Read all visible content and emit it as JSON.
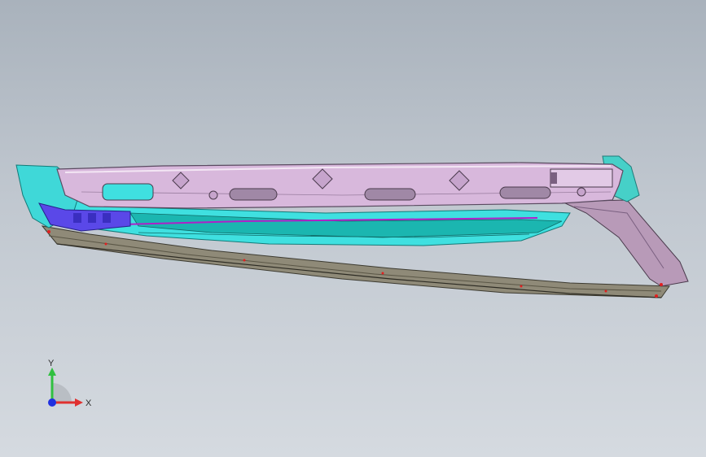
{
  "viewport": {
    "background_top": "#a9b2bc",
    "background_bottom": "#d5dae0"
  },
  "model": {
    "colors": {
      "outer_panel": "#d8b8dc",
      "panel_edge": "#5a4a60",
      "inner_cyan": "#3fe0e0",
      "inner_teal": "#1bb6b0",
      "blue_parts": "#5a48e8",
      "magenta_line": "#b020c8",
      "lower_rail": "#8f8a78",
      "rail_edge": "#3c3a30",
      "rear_pillar": "#b89ab8",
      "marker": "#e02020"
    }
  },
  "triad": {
    "x_label": "X",
    "y_label": "Y",
    "x_color": "#e03030",
    "y_color": "#30c040",
    "z_color": "#2030e0"
  }
}
